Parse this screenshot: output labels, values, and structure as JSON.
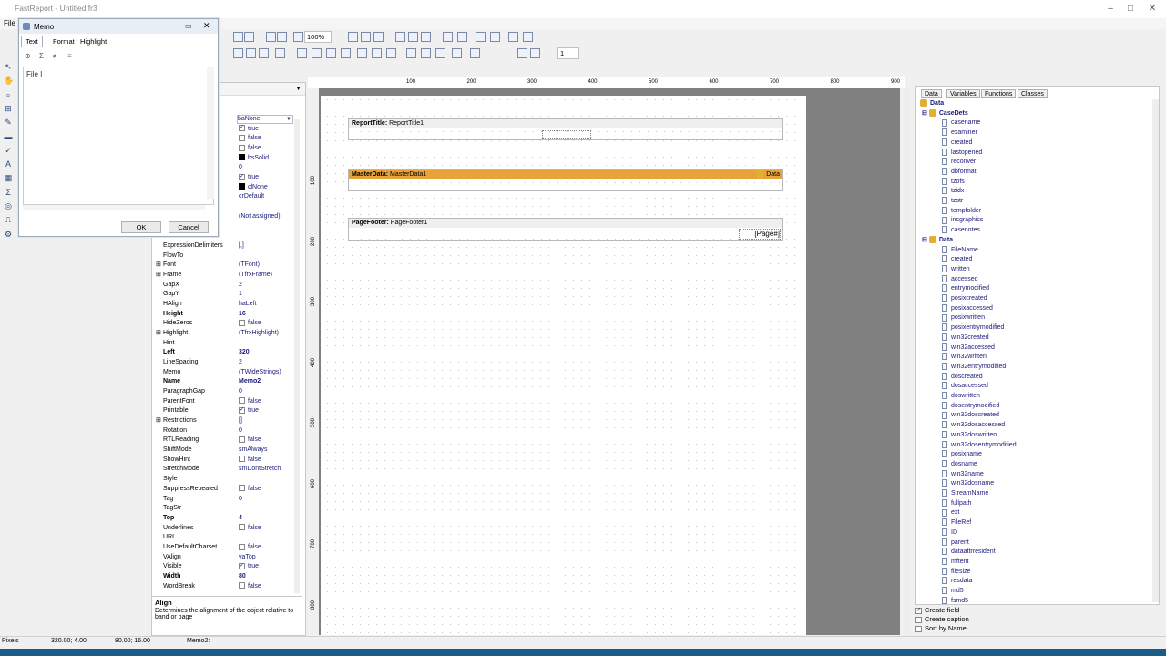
{
  "window": {
    "title": "FastReport - Untitled.fr3"
  },
  "menubar": {
    "file": "File"
  },
  "toolbar": {
    "zoom": "100%",
    "frame_width": "1"
  },
  "memo_dialog": {
    "title": "Memo",
    "tabs": [
      "Text",
      "Format",
      "Highlight"
    ],
    "text": "File I",
    "ok": "OK",
    "cancel": "Cancel"
  },
  "inspector": {
    "rows": [
      {
        "n": "",
        "v": "baNone",
        "t": "combo"
      },
      {
        "n": "",
        "v": "true",
        "t": "cbon"
      },
      {
        "n": "",
        "v": "false",
        "t": "cb"
      },
      {
        "n": "",
        "v": "false",
        "t": "cb"
      },
      {
        "n": "",
        "v": "bsSolid",
        "t": "sw"
      },
      {
        "n": "",
        "v": "0"
      },
      {
        "n": "",
        "v": "true",
        "t": "cbon"
      },
      {
        "n": "",
        "v": "clNone",
        "t": "sw"
      },
      {
        "n": "",
        "v": "crDefault"
      },
      {
        "n": "",
        "v": ""
      },
      {
        "n": "",
        "v": "(Not assigned)"
      },
      {
        "n": "",
        "v": ""
      },
      {
        "n": "",
        "v": ""
      },
      {
        "n": "ExpressionDelimiters",
        "v": "[,]"
      },
      {
        "n": "FlowTo",
        "v": ""
      },
      {
        "n": "Font",
        "v": "(TFont)",
        "x": "1"
      },
      {
        "n": "Frame",
        "v": "(TfrxFrame)",
        "x": "1"
      },
      {
        "n": "GapX",
        "v": "2"
      },
      {
        "n": "GapY",
        "v": "1"
      },
      {
        "n": "HAlign",
        "v": "haLeft"
      },
      {
        "n": "Height",
        "v": "16",
        "b": "1"
      },
      {
        "n": "HideZeros",
        "v": "false",
        "t": "cb"
      },
      {
        "n": "Highlight",
        "v": "(TfrxHighlight)",
        "x": "1"
      },
      {
        "n": "Hint",
        "v": ""
      },
      {
        "n": "Left",
        "v": "320",
        "b": "1"
      },
      {
        "n": "LineSpacing",
        "v": "2"
      },
      {
        "n": "Memo",
        "v": "(TWideStrings)"
      },
      {
        "n": "Name",
        "v": "Memo2",
        "b": "1"
      },
      {
        "n": "ParagraphGap",
        "v": "0"
      },
      {
        "n": "ParentFont",
        "v": "false",
        "t": "cb"
      },
      {
        "n": "Printable",
        "v": "true",
        "t": "cbon"
      },
      {
        "n": "Restrictions",
        "v": "[]",
        "x": "1"
      },
      {
        "n": "Rotation",
        "v": "0"
      },
      {
        "n": "RTLReading",
        "v": "false",
        "t": "cb"
      },
      {
        "n": "ShiftMode",
        "v": "smAlways"
      },
      {
        "n": "ShowHint",
        "v": "false",
        "t": "cb"
      },
      {
        "n": "StretchMode",
        "v": "smDontStretch"
      },
      {
        "n": "Style",
        "v": ""
      },
      {
        "n": "SuppressRepeated",
        "v": "false",
        "t": "cb"
      },
      {
        "n": "Tag",
        "v": "0"
      },
      {
        "n": "TagStr",
        "v": ""
      },
      {
        "n": "Top",
        "v": "4",
        "b": "1"
      },
      {
        "n": "Underlines",
        "v": "false",
        "t": "cb"
      },
      {
        "n": "URL",
        "v": ""
      },
      {
        "n": "UseDefaultCharset",
        "v": "false",
        "t": "cb"
      },
      {
        "n": "VAlign",
        "v": "vaTop"
      },
      {
        "n": "Visible",
        "v": "true",
        "t": "cbon"
      },
      {
        "n": "Width",
        "v": "80",
        "b": "1"
      },
      {
        "n": "WordBreak",
        "v": "false",
        "t": "cb"
      }
    ],
    "hint_title": "Align",
    "hint_text": "Determines the alignment of the object relative to band or page"
  },
  "ruler": {
    "h": [
      "100",
      "200",
      "300",
      "400",
      "500",
      "600",
      "700",
      "800",
      "900"
    ],
    "v": [
      "100",
      "200",
      "300",
      "400",
      "500",
      "600",
      "700",
      "800"
    ]
  },
  "bands": {
    "report_title": {
      "kind": "ReportTitle:",
      "name": "ReportTitle1"
    },
    "master_data": {
      "kind": "MasterData:",
      "name": "MasterData1",
      "ds": "Data"
    },
    "page_footer": {
      "kind": "PageFooter:",
      "name": "PageFooter1",
      "page": "[Page#]"
    }
  },
  "data_tree": {
    "tabs": [
      "Data",
      "Variables",
      "Functions",
      "Classes"
    ],
    "root": "Data",
    "groups": [
      {
        "name": "CaseDets",
        "fields": [
          "casename",
          "examiner",
          "created",
          "lastopened",
          "reconver",
          "dbformat",
          "tzofs",
          "tzidx",
          "tzstr",
          "tempfolder",
          "incgraphics",
          "casenotes"
        ]
      },
      {
        "name": "Data",
        "fields": [
          "FileName",
          "created",
          "written",
          "accessed",
          "entrymodified",
          "posixcreated",
          "posixaccessed",
          "posixwritten",
          "posixentrymodified",
          "win32created",
          "win32accessed",
          "win32written",
          "win32entrymodified",
          "doscreated",
          "dosaccessed",
          "doswritten",
          "dosentrymodified",
          "win32doscreated",
          "win32dosaccessed",
          "win32doswritten",
          "win32dosentrymodified",
          "posixname",
          "dosname",
          "win32name",
          "win32dosname",
          "StreamName",
          "fullpath",
          "ext",
          "FileRef",
          "ID",
          "parent",
          "dataattrresident",
          "mftent",
          "filesize",
          "resdata",
          "md5",
          "fsmd5"
        ]
      }
    ]
  },
  "options": {
    "create_field": "Create field",
    "create_caption": "Create caption",
    "sort_by_name": "Sort by Name"
  },
  "status": {
    "units": "Pixels",
    "pos": "320.00; 4.00",
    "size": "80.00; 16.00",
    "object": "Memo2:"
  }
}
